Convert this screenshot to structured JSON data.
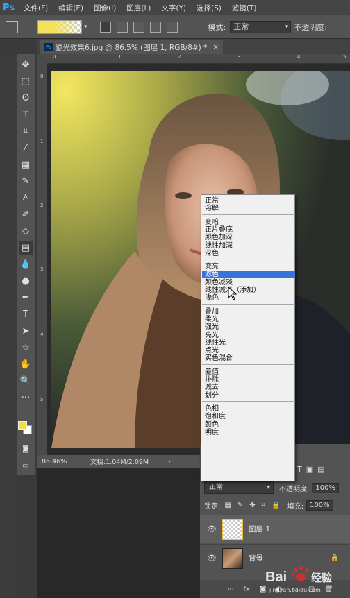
{
  "app": {
    "logo": "Ps"
  },
  "menubar": {
    "items": [
      "文件(F)",
      "编辑(E)",
      "图像(I)",
      "图层(L)",
      "文字(Y)",
      "选择(S)",
      "滤镜(T)"
    ]
  },
  "options": {
    "gradient_colors": [
      "#f3e15a",
      "transparent"
    ],
    "mode_label": "模式:",
    "mode_value": "正常",
    "opacity_label": "不透明度:"
  },
  "document": {
    "tab_title": "逆光效果6.jpg @ 86.5% (图层 1, RGB/8#) *",
    "close": "×"
  },
  "rulers": {
    "h_ticks": [
      "0",
      "1",
      "2",
      "3",
      "4",
      "5",
      "6"
    ],
    "v_ticks": [
      "0",
      "1",
      "2",
      "3",
      "4",
      "5"
    ]
  },
  "status": {
    "zoom": "86.46%",
    "doc_info": "文档:1.04M/2.09M",
    "arrow": "›"
  },
  "tools": {
    "items": [
      "move",
      "marquee",
      "lasso",
      "magic-wand",
      "crop",
      "eyedropper",
      "healing",
      "brush",
      "stamp",
      "history-brush",
      "eraser",
      "gradient",
      "blur",
      "dodge",
      "pen",
      "type",
      "path-select",
      "shape",
      "hand",
      "zoom",
      "more"
    ],
    "foreground_color": "#f2dd48",
    "background_color": "#ffffff"
  },
  "blend_menu": {
    "groups": [
      [
        "正常",
        "溶解"
      ],
      [
        "变暗",
        "正片叠底",
        "颜色加深",
        "线性加深",
        "深色"
      ],
      [
        "变亮",
        "滤色",
        "颜色减淡",
        "线性减淡（添加）",
        "浅色"
      ],
      [
        "叠加",
        "柔光",
        "强光",
        "亮光",
        "线性光",
        "点光",
        "实色混合"
      ],
      [
        "差值",
        "排除",
        "减去",
        "划分"
      ],
      [
        "色相",
        "饱和度",
        "颜色",
        "明度"
      ]
    ],
    "highlighted": "滤色",
    "highlight_color": "#3873d8"
  },
  "layers": {
    "blend_value": "正常",
    "opacity_label": "不透明度:",
    "opacity_value": "100%",
    "lock_label": "锁定:",
    "fill_label": "填充:",
    "fill_value": "100%",
    "items": [
      {
        "name": "图层 1",
        "selected": true,
        "visible": true
      },
      {
        "name": "背景",
        "selected": false,
        "visible": true,
        "locked": true
      }
    ],
    "bottom_icons": [
      "link",
      "fx",
      "mask",
      "adjustment",
      "group",
      "new-layer",
      "trash"
    ]
  },
  "watermark": {
    "brand": "Bai",
    "brand_cn": "经验",
    "url": "jingyan.baidu.com"
  }
}
